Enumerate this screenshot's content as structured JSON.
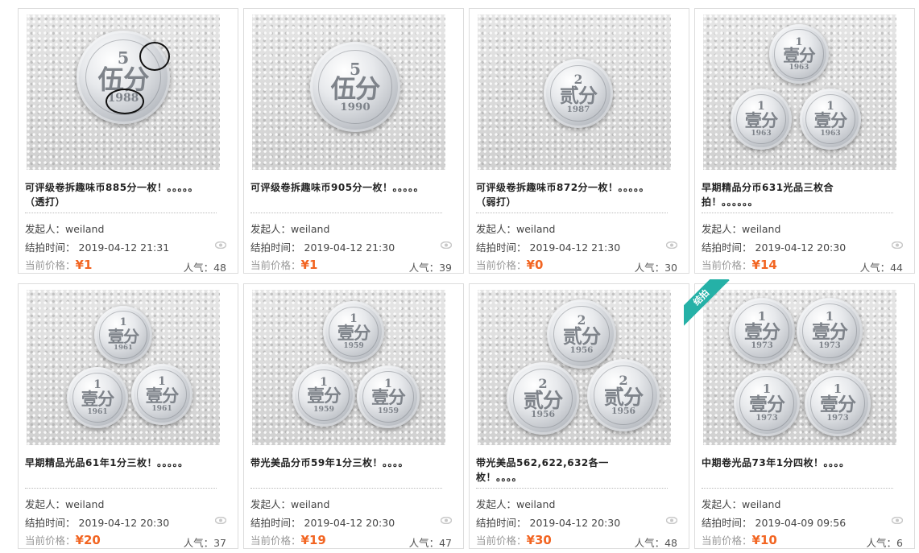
{
  "labels": {
    "initiator": "发起人：",
    "end_time": "结拍时间：",
    "price": "当前价格：",
    "popularity": "人气："
  },
  "accent_color": "#f26522",
  "badge_color": "#25b1a7",
  "items": [
    {
      "title_line1": "可评级卷拆趣味币885分一枚！。。。。。",
      "title_line2": "（透打）",
      "user": "weiland",
      "time": "2019-04-12 21:31",
      "price": "¥1",
      "popularity": "48",
      "coins": [
        {
          "num": "5",
          "txt": "伍分",
          "yr": "1988"
        }
      ]
    },
    {
      "title_line1": "可评级卷拆趣味币905分一枚！。。。。。",
      "title_line2": "",
      "user": "weiland",
      "time": "2019-04-12 21:30",
      "price": "¥1",
      "popularity": "39",
      "coins": [
        {
          "num": "5",
          "txt": "伍分",
          "yr": "1990"
        }
      ]
    },
    {
      "title_line1": "可评级卷拆趣味币872分一枚！。。。。。",
      "title_line2": "（弱打）",
      "user": "weiland",
      "time": "2019-04-12 21:30",
      "price": "¥0",
      "popularity": "30",
      "coins": [
        {
          "num": "2",
          "txt": "贰分",
          "yr": "1987"
        }
      ]
    },
    {
      "title_line1": "早期精品分币631光品三枚合",
      "title_line2": "拍！。。。。。。",
      "user": "weiland",
      "time": "2019-04-12 20:30",
      "price": "¥14",
      "popularity": "44",
      "coins": [
        {
          "num": "1",
          "txt": "壹分",
          "yr": "1963"
        }
      ]
    },
    {
      "title_line1": "早期精品光品61年1分三枚！。。。。。",
      "title_line2": "",
      "user": "weiland",
      "time": "2019-04-12 20:30",
      "price": "¥20",
      "popularity": "37",
      "coins": [
        {
          "num": "1",
          "txt": "壹分",
          "yr": "1961"
        }
      ]
    },
    {
      "title_line1": "带光美品分币59年1分三枚！。。。。",
      "title_line2": "",
      "user": "weiland",
      "time": "2019-04-12 20:30",
      "price": "¥19",
      "popularity": "47",
      "coins": [
        {
          "num": "1",
          "txt": "壹分",
          "yr": "1959"
        }
      ]
    },
    {
      "title_line1": "带光美品562,622,632各一",
      "title_line2": "枚！。。。。",
      "user": "weiland",
      "time": "2019-04-12 20:30",
      "price": "¥30",
      "popularity": "48",
      "coins": [
        {
          "num": "2",
          "txt": "贰分",
          "yr": "1956"
        }
      ]
    },
    {
      "title_line1": "中期卷光品73年1分四枚！。。。。",
      "title_line2": "",
      "user": "weiland",
      "time": "2019-04-09 09:56",
      "price": "¥10",
      "popularity": "6",
      "badge": "结拍",
      "coins": [
        {
          "num": "1",
          "txt": "壹分",
          "yr": "1973"
        }
      ]
    }
  ]
}
